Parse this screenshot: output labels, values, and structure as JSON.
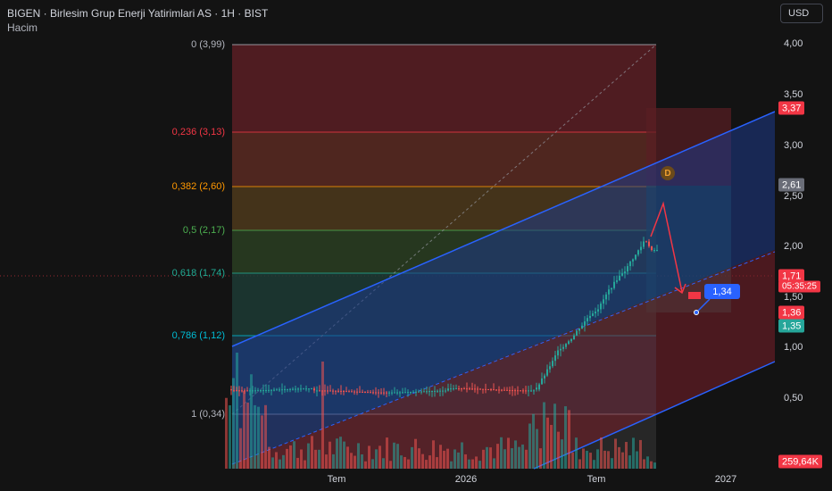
{
  "header": {
    "title": "BIGEN · Birlesim Grup Enerji Yatirimlari AS · 1H · BIST",
    "indicator": "Hacim"
  },
  "currency": "USD",
  "price_axis": {
    "ticks": [
      "4,00",
      "3,50",
      "3,00",
      "2,50",
      "2,00",
      "1,50",
      "1,00",
      "0,50"
    ]
  },
  "price_labels": {
    "high_label": "3,37",
    "mid_label": "2,61",
    "last_price": "1,71",
    "countdown": "05:35:25",
    "red_label": "1,36",
    "green_label": "1,35",
    "volume": "259,64K"
  },
  "fib_levels": [
    {
      "label": "0 (3,99)",
      "color": "#b2b5be"
    },
    {
      "label": "0,236 (3,13)",
      "color": "#f23645"
    },
    {
      "label": "0,382 (2,60)",
      "color": "#ff9800"
    },
    {
      "label": "0,5 (2,17)",
      "color": "#4caf50"
    },
    {
      "label": "0,618 (1,74)",
      "color": "#22ab94"
    },
    {
      "label": "0,786 (1,12)",
      "color": "#00bcd4"
    },
    {
      "label": "1 (0,34)",
      "color": "#b2b5be"
    }
  ],
  "time_axis": [
    "Tem",
    "2026",
    "Tem",
    "2027"
  ],
  "callout": {
    "label": "1,34"
  },
  "marker": {
    "label": "D"
  },
  "colors": {
    "up": "#26a69a",
    "down": "#ef5350",
    "channel": "#2962ff",
    "background": "#131313"
  }
}
